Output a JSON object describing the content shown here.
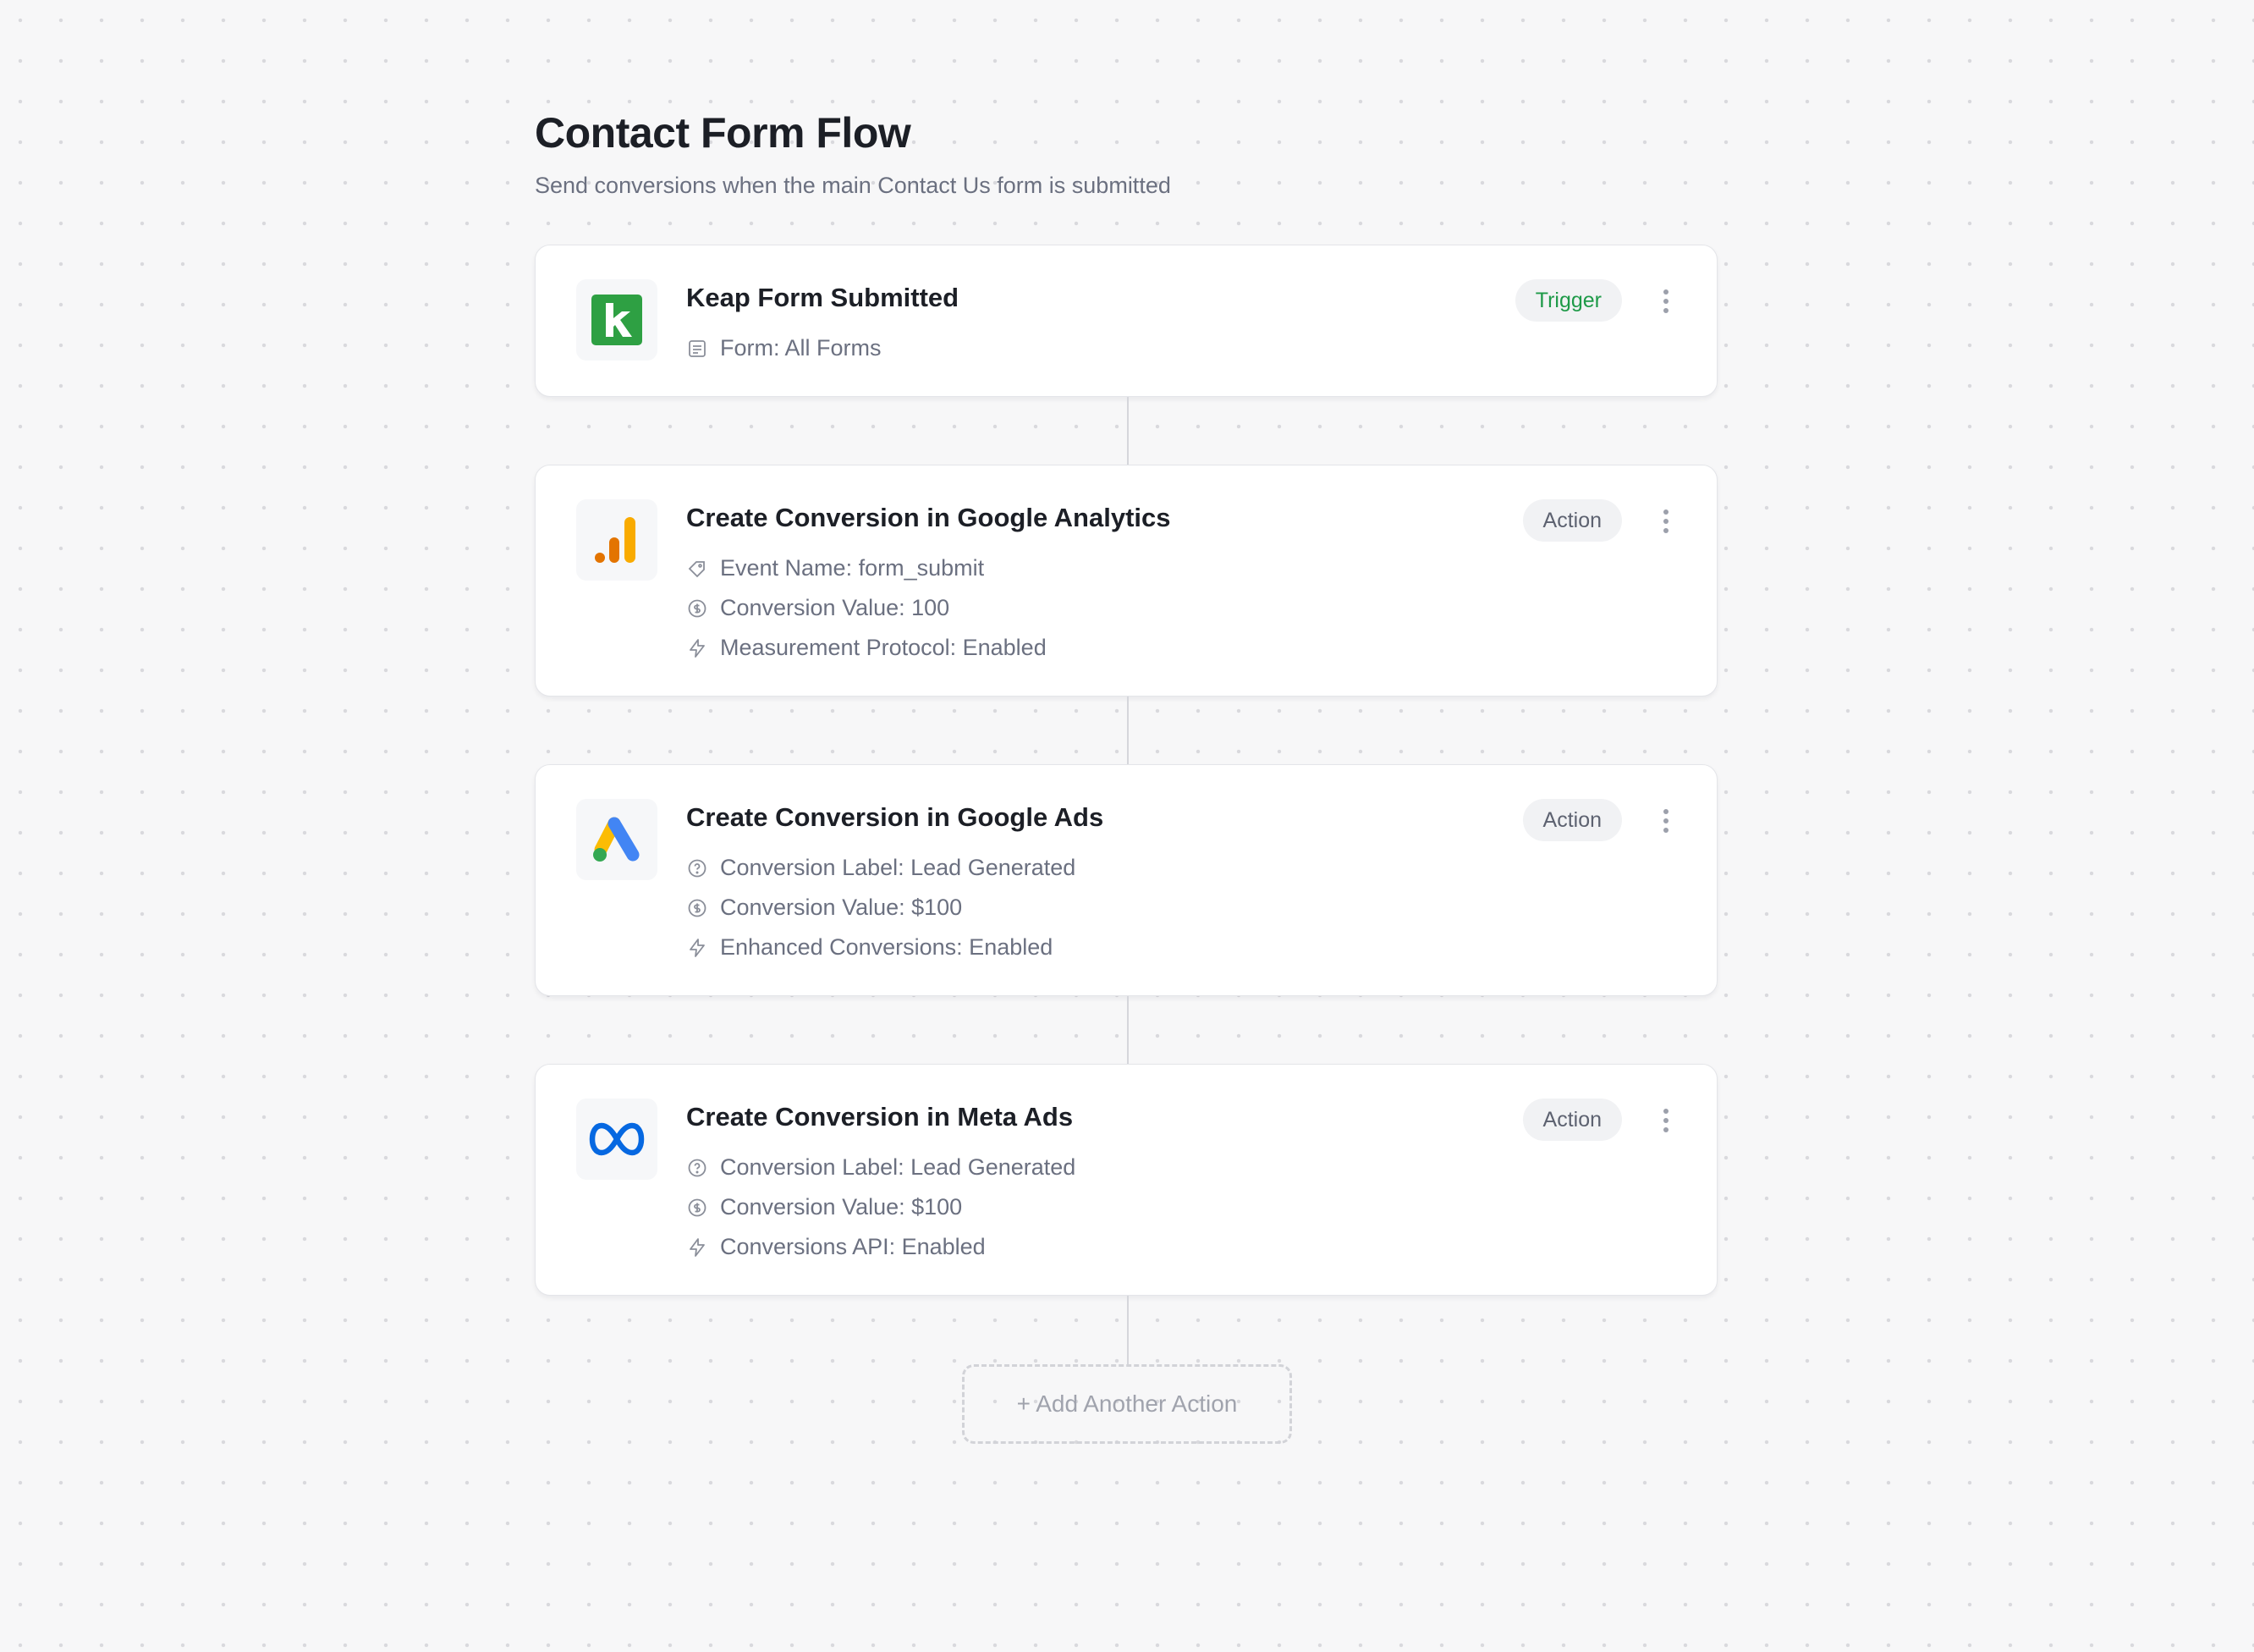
{
  "flow": {
    "title": "Contact Form Flow",
    "subtitle": "Send conversions when the main Contact Us form is submitted"
  },
  "steps": [
    {
      "title": "Keap Form Submitted",
      "badge": "Trigger",
      "logo_icon": "keap-logo-icon",
      "details": [
        {
          "icon": "form-icon",
          "text": "Form: All Forms"
        }
      ]
    },
    {
      "title": "Create Conversion in Google Analytics",
      "badge": "Action",
      "logo_icon": "google-analytics-logo-icon",
      "details": [
        {
          "icon": "tag-icon",
          "text": "Event Name: form_submit"
        },
        {
          "icon": "dollar-circle-icon",
          "text": "Conversion Value: 100"
        },
        {
          "icon": "bolt-icon",
          "text": "Measurement Protocol: Enabled"
        }
      ]
    },
    {
      "title": "Create Conversion in Google Ads",
      "badge": "Action",
      "logo_icon": "google-ads-logo-icon",
      "details": [
        {
          "icon": "question-circle-icon",
          "text": "Conversion Label: Lead Generated"
        },
        {
          "icon": "dollar-circle-icon",
          "text": "Conversion Value: $100"
        },
        {
          "icon": "bolt-icon",
          "text": "Enhanced Conversions: Enabled"
        }
      ]
    },
    {
      "title": "Create Conversion in Meta Ads",
      "badge": "Action",
      "logo_icon": "meta-logo-icon",
      "details": [
        {
          "icon": "question-circle-icon",
          "text": "Conversion Label: Lead Generated"
        },
        {
          "icon": "dollar-circle-icon",
          "text": "Conversion Value: $100"
        },
        {
          "icon": "bolt-icon",
          "text": "Conversions API: Enabled"
        }
      ]
    }
  ],
  "add_action": {
    "label": "+ Add Another Action"
  },
  "colors": {
    "trigger_badge_text": "#1e9a48",
    "keap_green": "#2ea043",
    "ga_orange": "#e37400",
    "ga_yellow": "#f9ab00",
    "ads_blue": "#4285f4",
    "ads_yellow": "#fbbc04",
    "ads_green": "#34a853",
    "meta_blue": "#0668e1"
  }
}
